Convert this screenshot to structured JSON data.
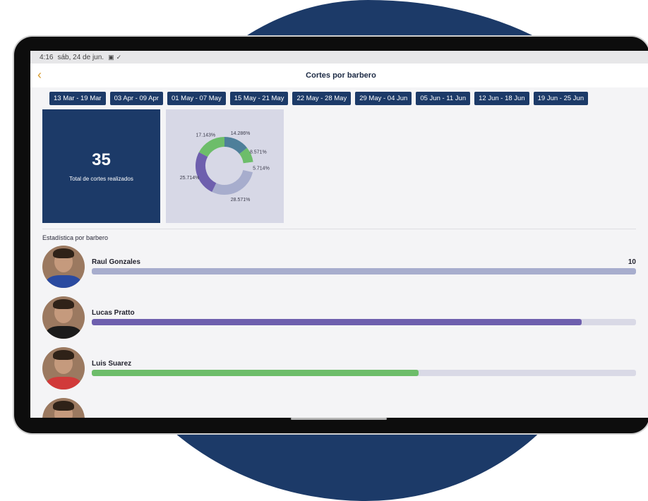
{
  "status_bar": {
    "time": "4:16",
    "date": "sáb, 24 de jun.",
    "icons": [
      "image-icon",
      "check-icon"
    ]
  },
  "app_bar": {
    "back_icon": "chevron-left-icon",
    "title": "Cortes por barbero"
  },
  "weeks": [
    "13 Mar - 19 Mar",
    "03 Apr - 09 Apr",
    "01 May - 07 May",
    "15 May - 21 May",
    "22 May - 28 May",
    "29 May - 04 Jun",
    "05 Jun - 11 Jun",
    "12 Jun - 18 Jun",
    "19 Jun - 25 Jun"
  ],
  "total": {
    "value": "35",
    "label": "Total de cortes realizados"
  },
  "chart_data": {
    "type": "pie",
    "donut": true,
    "slices": [
      {
        "label": "14.286%",
        "value": 14.286,
        "color": "#4e7f9a"
      },
      {
        "label": "8.571%",
        "value": 8.571,
        "color": "#6dbd6a"
      },
      {
        "label": "5.714%",
        "value": 5.714,
        "color": "#d7d8e6"
      },
      {
        "label": "28.571%",
        "value": 28.571,
        "color": "#a7adcd"
      },
      {
        "label": "25.714%",
        "value": 25.714,
        "color": "#6e5fae"
      },
      {
        "label": "17.143%",
        "value": 17.143,
        "color": "#6dbd6a"
      }
    ]
  },
  "section_label": "Estadística por barbero",
  "barbers": [
    {
      "name": "Raul Gonzales",
      "count": "10",
      "fraction": 1.0,
      "color": "#a7adcd",
      "shirt": "#2a4aa0"
    },
    {
      "name": "Lucas Pratto",
      "count": "",
      "fraction": 0.9,
      "color": "#6e5fae",
      "shirt": "#1b1b1b"
    },
    {
      "name": "Luis Suarez",
      "count": "",
      "fraction": 0.6,
      "color": "#6dbd6a",
      "shirt": "#d13a3a"
    }
  ]
}
